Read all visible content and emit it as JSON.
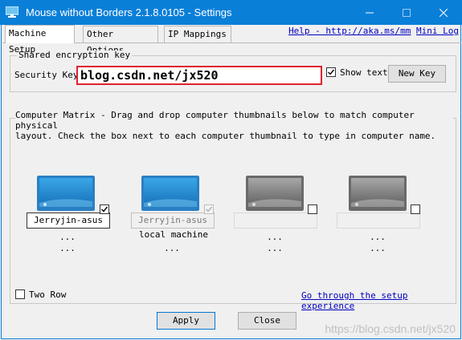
{
  "window": {
    "title": "Mouse without Borders 2.1.8.0105 - Settings"
  },
  "tabs": [
    {
      "label": "Machine Setup",
      "active": true
    },
    {
      "label": "Other Options",
      "active": false
    },
    {
      "label": "IP Mappings",
      "active": false
    }
  ],
  "links": {
    "help": "Help - http://aka.ms/mm",
    "mini_log": "Mini Log"
  },
  "encryption": {
    "group_label": "Shared encryption key",
    "field_label": "Security Key:",
    "value": "blog.csdn.net/jx520",
    "show_text_label": "Show text",
    "show_text_checked": true,
    "new_key_label": "New Key"
  },
  "matrix": {
    "group_label": "Computer Matrix",
    "description_1": "- Drag and drop computer thumbnails below to match computer physical",
    "description_2": "layout. Check the box next to each computer thumbnail to type in computer name.",
    "computers": [
      {
        "name": "Jerryjin-asus",
        "checked": true,
        "enabled": true,
        "status": "...",
        "status2": "..."
      },
      {
        "name": "Jerryjin-asus",
        "checked": true,
        "enabled": false,
        "status": "local machine",
        "status2": "..."
      },
      {
        "name": "",
        "checked": false,
        "enabled": false,
        "status": "...",
        "status2": "..."
      },
      {
        "name": "",
        "checked": false,
        "enabled": false,
        "status": "...",
        "status2": "..."
      }
    ],
    "two_row_label": "Two Row",
    "two_row_checked": false,
    "setup_link": "Go through the setup experience"
  },
  "footer": {
    "apply_label": "Apply",
    "close_label": "Close"
  },
  "watermark": "https://blog.csdn.net/jx520",
  "colors": {
    "title_bar": "#0a7fd8",
    "link": "#0000c0",
    "highlight_border": "#e0202f"
  }
}
